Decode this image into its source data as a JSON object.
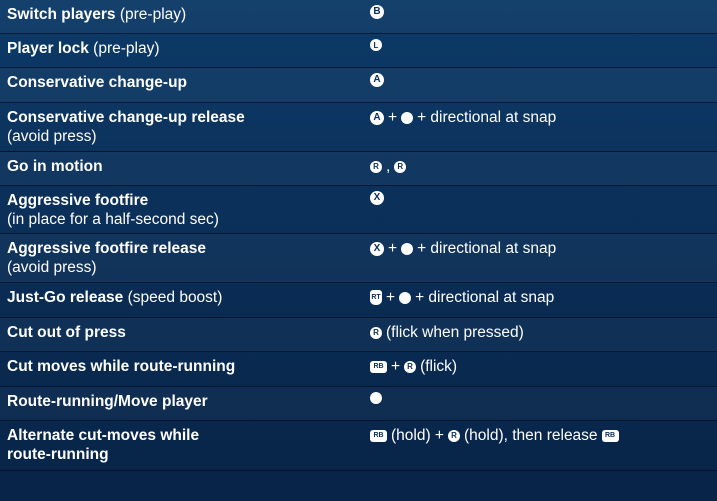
{
  "rows": [
    {
      "action_bold": "Switch players",
      "action_rest": " (pre-play)",
      "sub": "",
      "binding": [
        {
          "type": "btn",
          "label": "B",
          "icon": "b-button-icon"
        }
      ]
    },
    {
      "action_bold": "Player lock",
      "action_rest": " (pre-play)",
      "sub": "",
      "binding": [
        {
          "type": "stick",
          "label": "L",
          "icon": "left-stick-click-icon"
        }
      ]
    },
    {
      "action_bold": "Conservative change-up",
      "action_rest": "",
      "sub": "",
      "binding": [
        {
          "type": "btn",
          "label": "A",
          "icon": "a-button-icon"
        }
      ]
    },
    {
      "action_bold": "Conservative change-up release",
      "action_rest": "",
      "sub": "(avoid press)",
      "binding": [
        {
          "type": "btn",
          "label": "A",
          "icon": "a-button-icon"
        },
        {
          "type": "txt",
          "text": "+"
        },
        {
          "type": "stick",
          "label": "",
          "icon": "left-stick-icon"
        },
        {
          "type": "txt",
          "text": "+ directional at snap"
        }
      ]
    },
    {
      "action_bold": "Go in motion",
      "action_rest": "",
      "sub": "",
      "binding": [
        {
          "type": "stick",
          "label": "R",
          "icon": "right-stick-left-icon"
        },
        {
          "type": "txt",
          "text": ","
        },
        {
          "type": "stick",
          "label": "R",
          "icon": "right-stick-right-icon"
        }
      ]
    },
    {
      "action_bold": "Aggressive footfire",
      "action_rest": "",
      "sub": "(in place for a half-second sec)",
      "binding": [
        {
          "type": "btn",
          "label": "X",
          "icon": "x-button-icon"
        }
      ]
    },
    {
      "action_bold": "Aggressive footfire release",
      "action_rest": "",
      "sub": "(avoid press)",
      "binding": [
        {
          "type": "btn",
          "label": "X",
          "icon": "x-button-icon"
        },
        {
          "type": "txt",
          "text": "+"
        },
        {
          "type": "stick",
          "label": "",
          "icon": "left-stick-icon"
        },
        {
          "type": "txt",
          "text": "+ directional at snap"
        }
      ]
    },
    {
      "action_bold": "Just-Go release",
      "action_rest": " (speed boost)",
      "sub": "",
      "binding": [
        {
          "type": "trigger",
          "label": "RT",
          "icon": "rt-trigger-icon"
        },
        {
          "type": "txt",
          "text": "+"
        },
        {
          "type": "stick",
          "label": "",
          "icon": "left-stick-icon"
        },
        {
          "type": "txt",
          "text": "+ directional at snap"
        }
      ]
    },
    {
      "action_bold": "Cut out of press",
      "action_rest": "",
      "sub": "",
      "binding": [
        {
          "type": "stick",
          "label": "R",
          "icon": "right-stick-click-icon"
        },
        {
          "type": "txt",
          "text": "(flick when pressed)"
        }
      ]
    },
    {
      "action_bold": "Cut moves while route-running",
      "action_rest": "",
      "sub": "",
      "binding": [
        {
          "type": "bumper",
          "label": "RB",
          "icon": "rb-bumper-icon"
        },
        {
          "type": "txt",
          "text": "+"
        },
        {
          "type": "stick",
          "label": "R",
          "icon": "right-stick-icon"
        },
        {
          "type": "txt",
          "text": "(flick)"
        }
      ]
    },
    {
      "action_bold": "Route-running/Move player",
      "action_rest": "",
      "sub": "",
      "binding": [
        {
          "type": "stick",
          "label": "",
          "icon": "left-stick-icon"
        }
      ]
    },
    {
      "action_bold": "Alternate cut-moves while",
      "action_rest": "",
      "sub": "route-running",
      "sub_bold": true,
      "binding": [
        {
          "type": "bumper",
          "label": "RB",
          "icon": "rb-bumper-icon"
        },
        {
          "type": "txt",
          "text": "(hold) +"
        },
        {
          "type": "stick",
          "label": "R",
          "icon": "right-stick-click-icon"
        },
        {
          "type": "txt",
          "text": "(hold), then release"
        },
        {
          "type": "bumper",
          "label": "RB",
          "icon": "rb-bumper-icon"
        }
      ]
    }
  ],
  "colors": {
    "background": "#0b2f57",
    "text": "#ffffff"
  }
}
